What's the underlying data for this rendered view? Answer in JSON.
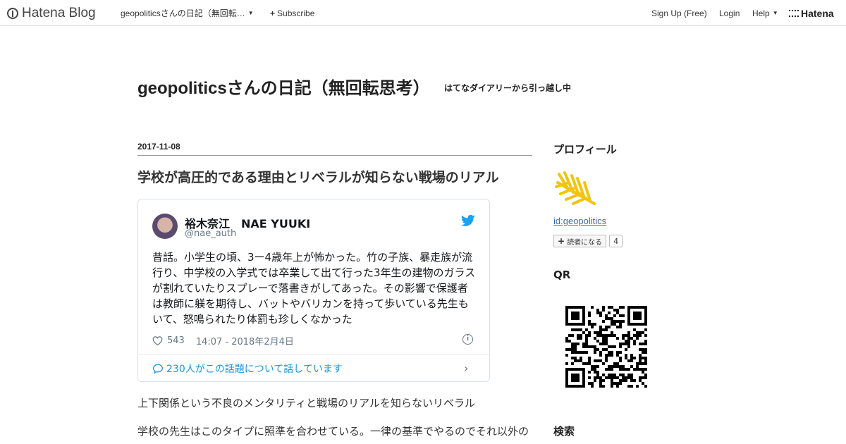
{
  "topbar": {
    "logo": "Hatena Blog",
    "blog_menu": "geopoliticsさんの日記（無回転…",
    "subscribe": "Subscribe",
    "signup": "Sign Up (Free)",
    "login": "Login",
    "help": "Help",
    "brand": "Hatena"
  },
  "blog": {
    "title": "geopoliticsさんの日記（無回転思考）",
    "description": "はてなダイアリーから引っ越し中"
  },
  "entry": {
    "date": "2017-11-08",
    "title": "学校が高圧的である理由とリベラルが知らない戦場のリアル",
    "tweet": {
      "name": "裕木奈江　NAE YUUKI",
      "handle": "@nae_auth",
      "text": "昔話。小学生の頃、3ー4歳年上が怖かった。竹の子族、暴走族が流行り、中学校の入学式では卒業して出て行った3年生の建物のガラスが割れていたりスプレーで落書きがしてあった。その影響で保護者は教師に躾を期待し、バットやバリカンを持って歩いている先生もいて、怒鳴られたり体罰も珍しくなかった",
      "likes": "543",
      "time": "14:07 - 2018年2月4日",
      "conversation": "230人がこの話題について話しています"
    },
    "paragraphs": [
      "上下関係という不良のメンタリティと戦場のリアルを知らないリベラル",
      "学校の先生はこのタイプに照準を合わせている。一律の基準でやるのでそれ以外の"
    ]
  },
  "sidebar": {
    "profile_heading": "プロフィール",
    "profile_id": "id:geopolitics",
    "follow_label": "読者になる",
    "follow_count": "4",
    "qr_heading": "QR",
    "search_heading": "検索"
  },
  "colors": {
    "twitter_blue": "#1da1f2",
    "link": "#3d6ea8"
  }
}
